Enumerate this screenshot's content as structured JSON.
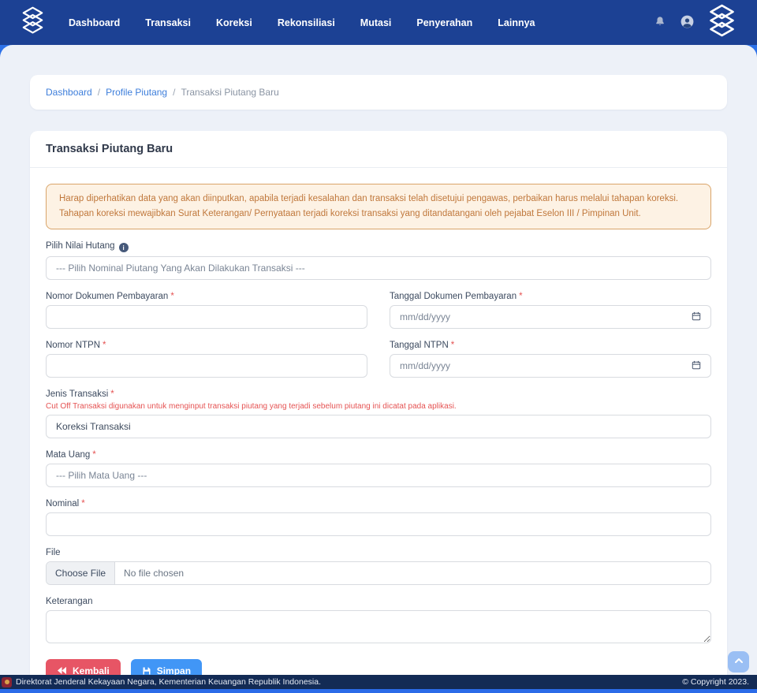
{
  "colors": {
    "navbar_bg": "#1c4194",
    "subheader_bg": "#2e72e8",
    "page_bg": "#edf1f8",
    "footer_bg": "#132b55",
    "footer_strip": "#2b6be8",
    "link": "#3d7edb",
    "danger": "#e55353",
    "button_back": "#e75565",
    "button_save": "#4196f6",
    "alert_bg": "#fdf2e4",
    "alert_border": "#d9a469",
    "alert_text": "#c0783c"
  },
  "navbar": {
    "items": [
      "Dashboard",
      "Transaksi",
      "Koreksi",
      "Rekonsiliasi",
      "Mutasi",
      "Penyerahan",
      "Lainnya"
    ]
  },
  "breadcrumb": {
    "separator": "/",
    "items": [
      "Dashboard",
      "Profile Piutang",
      "Transaksi Piutang Baru"
    ]
  },
  "card": {
    "title": "Transaksi Piutang Baru"
  },
  "alert": {
    "line1": "Harap diperhatikan data yang akan diinputkan, apabila terjadi kesalahan dan transaksi telah disetujui pengawas, perbaikan harus melalui tahapan koreksi.",
    "line2": "Tahapan koreksi mewajibkan Surat Keterangan/ Pernyataan terjadi koreksi transaksi yang ditandatangani oleh pejabat Eselon III / Pimpinan Unit."
  },
  "required_mark": "*",
  "glyphs": {
    "info": "i"
  },
  "form": {
    "pilih_nilai_hutang": {
      "label": "Pilih Nilai Hutang",
      "value": "--- Pilih Nominal Piutang Yang Akan Dilakukan Transaksi ---"
    },
    "nomor_dokumen_pembayaran": {
      "label": "Nomor Dokumen Pembayaran",
      "value": ""
    },
    "tanggal_dokumen_pembayaran": {
      "label": "Tanggal Dokumen Pembayaran",
      "placeholder": "mm/dd/yyyy"
    },
    "nomor_ntpn": {
      "label": "Nomor NTPN",
      "value": ""
    },
    "tanggal_ntpn": {
      "label": "Tanggal NTPN",
      "placeholder": "mm/dd/yyyy"
    },
    "jenis_transaksi": {
      "label": "Jenis Transaksi",
      "helper": "Cut Off Transaksi digunakan untuk menginput transaksi piutang yang terjadi sebelum piutang ini dicatat pada aplikasi.",
      "value": "Koreksi Transaksi"
    },
    "mata_uang": {
      "label": "Mata Uang",
      "value": "--- Pilih Mata Uang ---"
    },
    "nominal": {
      "label": "Nominal",
      "value": ""
    },
    "file": {
      "label": "File",
      "button_label": "Choose File",
      "status": "No file chosen"
    },
    "keterangan": {
      "label": "Keterangan",
      "value": ""
    }
  },
  "actions": {
    "back": "Kembali",
    "save": "Simpan"
  },
  "footer": {
    "left": "Direktorat Jenderal Kekayaan Negara, Kementerian Keuangan Republik Indonesia.",
    "right": "© Copyright 2023."
  }
}
